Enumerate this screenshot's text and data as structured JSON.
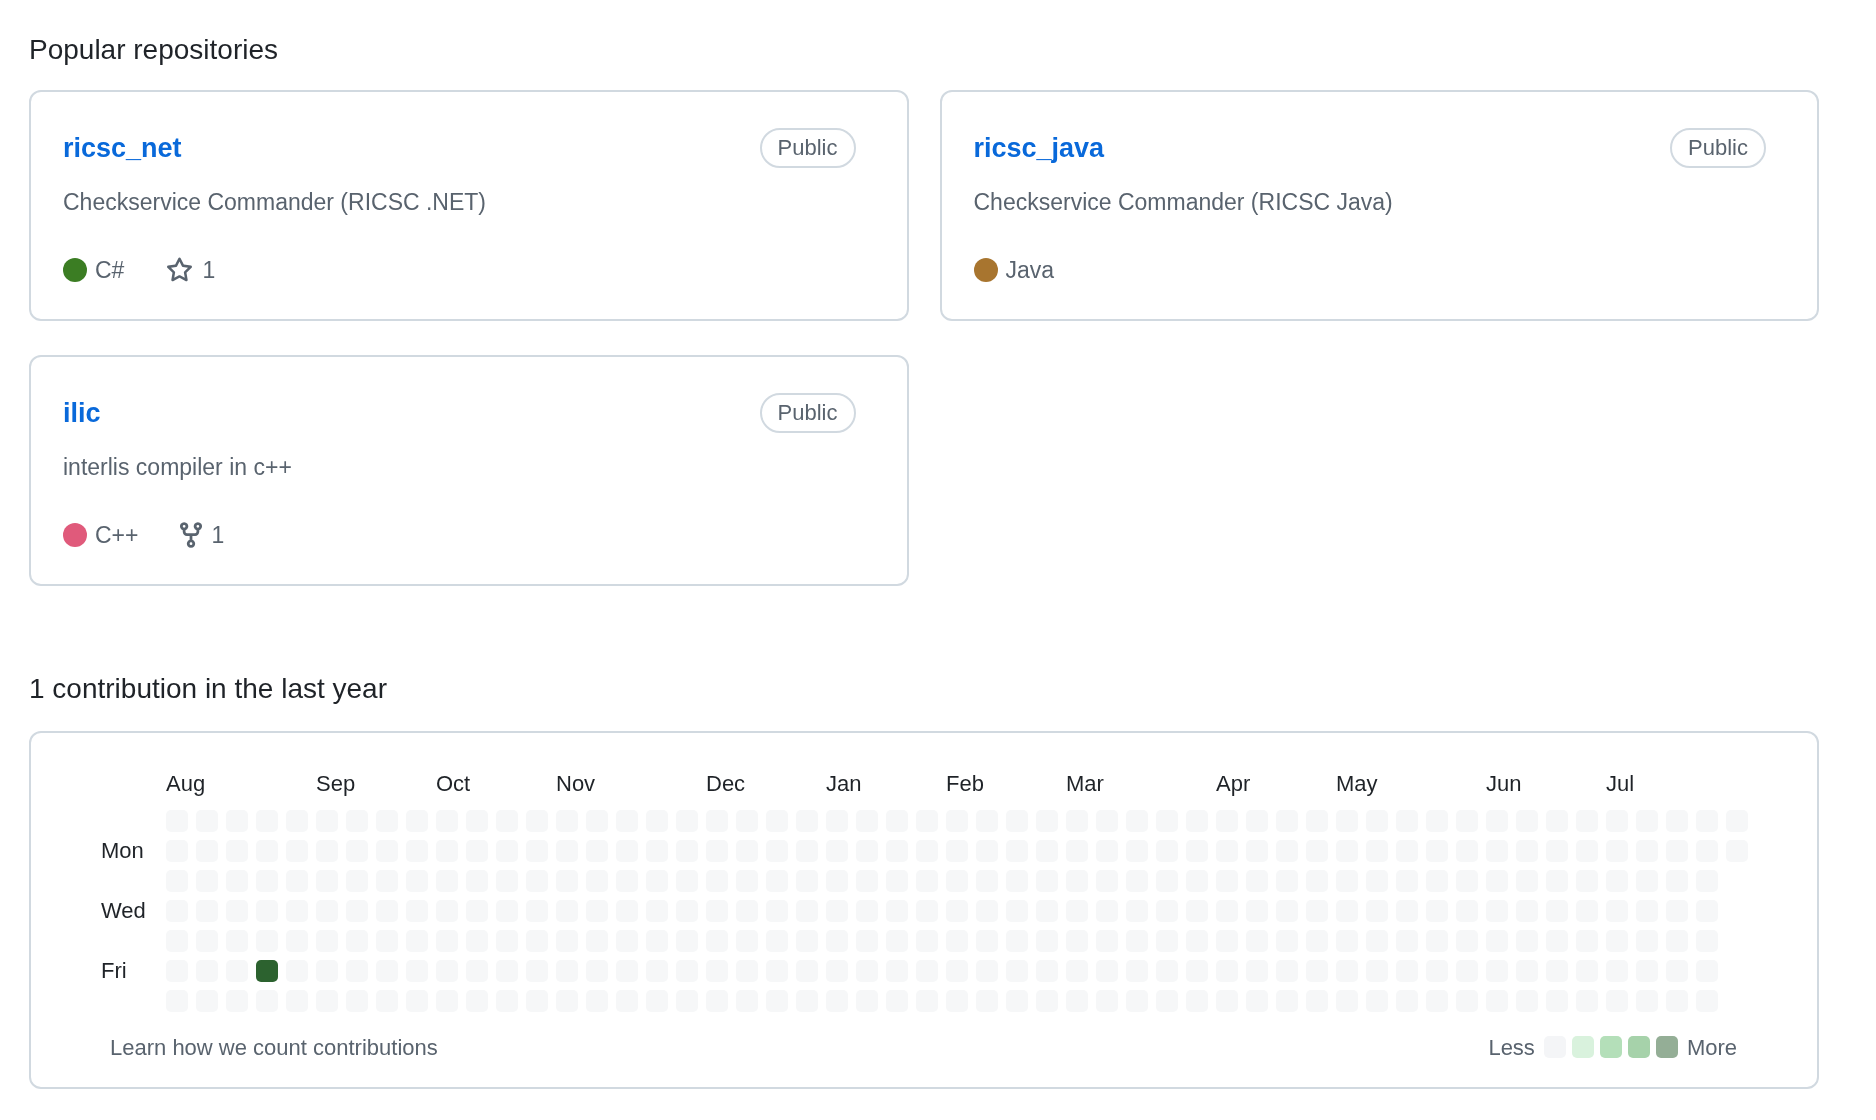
{
  "popular_repositories": {
    "title": "Popular repositories",
    "repos": [
      {
        "name": "ricsc_net",
        "visibility": "Public",
        "description": "Checkservice Commander (RICSC .NET)",
        "language": {
          "name": "C#",
          "color": "#3b7d23"
        },
        "stats": [
          {
            "kind": "stars",
            "count": "1"
          }
        ]
      },
      {
        "name": "ricsc_java",
        "visibility": "Public",
        "description": "Checkservice Commander (RICSC Java)",
        "language": {
          "name": "Java",
          "color": "#a8752f"
        }
      },
      {
        "name": "ilic",
        "visibility": "Public",
        "description": "interlis compiler in c++",
        "language": {
          "name": "C++",
          "color": "#e05a7b"
        },
        "stats": [
          {
            "kind": "forks",
            "count": "1"
          }
        ]
      }
    ]
  },
  "contributions": {
    "title": "1 contribution in the last year",
    "day_labels": [
      "Mon",
      "Wed",
      "Fri"
    ],
    "weeks": [
      {
        "month": "Aug",
        "days": [
          {
            "color": "#f6f7f8"
          },
          {
            "color": "#f6f7f8"
          },
          {
            "color": "#f6f7f8"
          },
          {
            "color": "#f6f7f8"
          },
          {
            "color": "#f6f7f8"
          },
          {
            "color": "#f6f7f8"
          },
          {
            "color": "#f6f7f8"
          }
        ]
      },
      {
        "days": [
          {
            "color": "#f6f7f8"
          },
          {
            "color": "#f6f7f8"
          },
          {
            "color": "#f6f7f8"
          },
          {
            "color": "#f6f7f8"
          },
          {
            "color": "#f6f7f8"
          },
          {
            "color": "#f6f7f8"
          },
          {
            "color": "#f6f7f8"
          }
        ]
      },
      {
        "days": [
          {
            "color": "#f6f7f8"
          },
          {
            "color": "#f6f7f8"
          },
          {
            "color": "#f6f7f8"
          },
          {
            "color": "#f6f7f8"
          },
          {
            "color": "#f6f7f8"
          },
          {
            "color": "#f6f7f8"
          },
          {
            "color": "#f6f7f8"
          }
        ]
      },
      {
        "days": [
          {
            "color": "#f6f7f8"
          },
          {
            "color": "#f6f7f8"
          },
          {
            "color": "#f6f7f8"
          },
          {
            "color": "#f6f7f8"
          },
          {
            "color": "#f6f7f8"
          },
          {
            "color": "#2c622f"
          },
          {
            "color": "#f6f7f8"
          }
        ]
      },
      {
        "days": [
          {
            "color": "#f6f7f8"
          },
          {
            "color": "#f6f7f8"
          },
          {
            "color": "#f6f7f8"
          },
          {
            "color": "#f6f7f8"
          },
          {
            "color": "#f6f7f8"
          },
          {
            "color": "#f6f7f8"
          },
          {
            "color": "#f6f7f8"
          }
        ]
      },
      {
        "month": "Sep",
        "days": [
          {
            "color": "#f6f7f8"
          },
          {
            "color": "#f6f7f8"
          },
          {
            "color": "#f6f7f8"
          },
          {
            "color": "#f6f7f8"
          },
          {
            "color": "#f6f7f8"
          },
          {
            "color": "#f6f7f8"
          },
          {
            "color": "#f6f7f8"
          }
        ]
      },
      {
        "days": [
          {
            "color": "#f6f7f8"
          },
          {
            "color": "#f6f7f8"
          },
          {
            "color": "#f6f7f8"
          },
          {
            "color": "#f6f7f8"
          },
          {
            "color": "#f6f7f8"
          },
          {
            "color": "#f6f7f8"
          },
          {
            "color": "#f6f7f8"
          }
        ]
      },
      {
        "days": [
          {
            "color": "#f6f7f8"
          },
          {
            "color": "#f6f7f8"
          },
          {
            "color": "#f6f7f8"
          },
          {
            "color": "#f6f7f8"
          },
          {
            "color": "#f6f7f8"
          },
          {
            "color": "#f6f7f8"
          },
          {
            "color": "#f6f7f8"
          }
        ]
      },
      {
        "days": [
          {
            "color": "#f6f7f8"
          },
          {
            "color": "#f6f7f8"
          },
          {
            "color": "#f6f7f8"
          },
          {
            "color": "#f6f7f8"
          },
          {
            "color": "#f6f7f8"
          },
          {
            "color": "#f6f7f8"
          },
          {
            "color": "#f6f7f8"
          }
        ]
      },
      {
        "month": "Oct",
        "days": [
          {
            "color": "#f6f7f8"
          },
          {
            "color": "#f6f7f8"
          },
          {
            "color": "#f6f7f8"
          },
          {
            "color": "#f6f7f8"
          },
          {
            "color": "#f6f7f8"
          },
          {
            "color": "#f6f7f8"
          },
          {
            "color": "#f6f7f8"
          }
        ]
      },
      {
        "days": [
          {
            "color": "#f6f7f8"
          },
          {
            "color": "#f6f7f8"
          },
          {
            "color": "#f6f7f8"
          },
          {
            "color": "#f6f7f8"
          },
          {
            "color": "#f6f7f8"
          },
          {
            "color": "#f6f7f8"
          },
          {
            "color": "#f6f7f8"
          }
        ]
      },
      {
        "days": [
          {
            "color": "#f6f7f8"
          },
          {
            "color": "#f6f7f8"
          },
          {
            "color": "#f6f7f8"
          },
          {
            "color": "#f6f7f8"
          },
          {
            "color": "#f6f7f8"
          },
          {
            "color": "#f6f7f8"
          },
          {
            "color": "#f6f7f8"
          }
        ]
      },
      {
        "days": [
          {
            "color": "#f6f7f8"
          },
          {
            "color": "#f6f7f8"
          },
          {
            "color": "#f6f7f8"
          },
          {
            "color": "#f6f7f8"
          },
          {
            "color": "#f6f7f8"
          },
          {
            "color": "#f6f7f8"
          },
          {
            "color": "#f6f7f8"
          }
        ]
      },
      {
        "month": "Nov",
        "days": [
          {
            "color": "#f6f7f8"
          },
          {
            "color": "#f6f7f8"
          },
          {
            "color": "#f6f7f8"
          },
          {
            "color": "#f6f7f8"
          },
          {
            "color": "#f6f7f8"
          },
          {
            "color": "#f6f7f8"
          },
          {
            "color": "#f6f7f8"
          }
        ]
      },
      {
        "days": [
          {
            "color": "#f6f7f8"
          },
          {
            "color": "#f6f7f8"
          },
          {
            "color": "#f6f7f8"
          },
          {
            "color": "#f6f7f8"
          },
          {
            "color": "#f6f7f8"
          },
          {
            "color": "#f6f7f8"
          },
          {
            "color": "#f6f7f8"
          }
        ]
      },
      {
        "days": [
          {
            "color": "#f6f7f8"
          },
          {
            "color": "#f6f7f8"
          },
          {
            "color": "#f6f7f8"
          },
          {
            "color": "#f6f7f8"
          },
          {
            "color": "#f6f7f8"
          },
          {
            "color": "#f6f7f8"
          },
          {
            "color": "#f6f7f8"
          }
        ]
      },
      {
        "days": [
          {
            "color": "#f6f7f8"
          },
          {
            "color": "#f6f7f8"
          },
          {
            "color": "#f6f7f8"
          },
          {
            "color": "#f6f7f8"
          },
          {
            "color": "#f6f7f8"
          },
          {
            "color": "#f6f7f8"
          },
          {
            "color": "#f6f7f8"
          }
        ]
      },
      {
        "days": [
          {
            "color": "#f6f7f8"
          },
          {
            "color": "#f6f7f8"
          },
          {
            "color": "#f6f7f8"
          },
          {
            "color": "#f6f7f8"
          },
          {
            "color": "#f6f7f8"
          },
          {
            "color": "#f6f7f8"
          },
          {
            "color": "#f6f7f8"
          }
        ]
      },
      {
        "month": "Dec",
        "days": [
          {
            "color": "#f6f7f8"
          },
          {
            "color": "#f6f7f8"
          },
          {
            "color": "#f6f7f8"
          },
          {
            "color": "#f6f7f8"
          },
          {
            "color": "#f6f7f8"
          },
          {
            "color": "#f6f7f8"
          },
          {
            "color": "#f6f7f8"
          }
        ]
      },
      {
        "days": [
          {
            "color": "#f6f7f8"
          },
          {
            "color": "#f6f7f8"
          },
          {
            "color": "#f6f7f8"
          },
          {
            "color": "#f6f7f8"
          },
          {
            "color": "#f6f7f8"
          },
          {
            "color": "#f6f7f8"
          },
          {
            "color": "#f6f7f8"
          }
        ]
      },
      {
        "days": [
          {
            "color": "#f6f7f8"
          },
          {
            "color": "#f6f7f8"
          },
          {
            "color": "#f6f7f8"
          },
          {
            "color": "#f6f7f8"
          },
          {
            "color": "#f6f7f8"
          },
          {
            "color": "#f6f7f8"
          },
          {
            "color": "#f6f7f8"
          }
        ]
      },
      {
        "days": [
          {
            "color": "#f6f7f8"
          },
          {
            "color": "#f6f7f8"
          },
          {
            "color": "#f6f7f8"
          },
          {
            "color": "#f6f7f8"
          },
          {
            "color": "#f6f7f8"
          },
          {
            "color": "#f6f7f8"
          },
          {
            "color": "#f6f7f8"
          }
        ]
      },
      {
        "month": "Jan",
        "days": [
          {
            "color": "#f6f7f8"
          },
          {
            "color": "#f6f7f8"
          },
          {
            "color": "#f6f7f8"
          },
          {
            "color": "#f6f7f8"
          },
          {
            "color": "#f6f7f8"
          },
          {
            "color": "#f6f7f8"
          },
          {
            "color": "#f6f7f8"
          }
        ]
      },
      {
        "days": [
          {
            "color": "#f6f7f8"
          },
          {
            "color": "#f6f7f8"
          },
          {
            "color": "#f6f7f8"
          },
          {
            "color": "#f6f7f8"
          },
          {
            "color": "#f6f7f8"
          },
          {
            "color": "#f6f7f8"
          },
          {
            "color": "#f6f7f8"
          }
        ]
      },
      {
        "days": [
          {
            "color": "#f6f7f8"
          },
          {
            "color": "#f6f7f8"
          },
          {
            "color": "#f6f7f8"
          },
          {
            "color": "#f6f7f8"
          },
          {
            "color": "#f6f7f8"
          },
          {
            "color": "#f6f7f8"
          },
          {
            "color": "#f6f7f8"
          }
        ]
      },
      {
        "days": [
          {
            "color": "#f6f7f8"
          },
          {
            "color": "#f6f7f8"
          },
          {
            "color": "#f6f7f8"
          },
          {
            "color": "#f6f7f8"
          },
          {
            "color": "#f6f7f8"
          },
          {
            "color": "#f6f7f8"
          },
          {
            "color": "#f6f7f8"
          }
        ]
      },
      {
        "month": "Feb",
        "days": [
          {
            "color": "#f6f7f8"
          },
          {
            "color": "#f6f7f8"
          },
          {
            "color": "#f6f7f8"
          },
          {
            "color": "#f6f7f8"
          },
          {
            "color": "#f6f7f8"
          },
          {
            "color": "#f6f7f8"
          },
          {
            "color": "#f6f7f8"
          }
        ]
      },
      {
        "days": [
          {
            "color": "#f6f7f8"
          },
          {
            "color": "#f6f7f8"
          },
          {
            "color": "#f6f7f8"
          },
          {
            "color": "#f6f7f8"
          },
          {
            "color": "#f6f7f8"
          },
          {
            "color": "#f6f7f8"
          },
          {
            "color": "#f6f7f8"
          }
        ]
      },
      {
        "days": [
          {
            "color": "#f6f7f8"
          },
          {
            "color": "#f6f7f8"
          },
          {
            "color": "#f6f7f8"
          },
          {
            "color": "#f6f7f8"
          },
          {
            "color": "#f6f7f8"
          },
          {
            "color": "#f6f7f8"
          },
          {
            "color": "#f6f7f8"
          }
        ]
      },
      {
        "days": [
          {
            "color": "#f6f7f8"
          },
          {
            "color": "#f6f7f8"
          },
          {
            "color": "#f6f7f8"
          },
          {
            "color": "#f6f7f8"
          },
          {
            "color": "#f6f7f8"
          },
          {
            "color": "#f6f7f8"
          },
          {
            "color": "#f6f7f8"
          }
        ]
      },
      {
        "month": "Mar",
        "days": [
          {
            "color": "#f6f7f8"
          },
          {
            "color": "#f6f7f8"
          },
          {
            "color": "#f6f7f8"
          },
          {
            "color": "#f6f7f8"
          },
          {
            "color": "#f6f7f8"
          },
          {
            "color": "#f6f7f8"
          },
          {
            "color": "#f6f7f8"
          }
        ]
      },
      {
        "days": [
          {
            "color": "#f6f7f8"
          },
          {
            "color": "#f6f7f8"
          },
          {
            "color": "#f6f7f8"
          },
          {
            "color": "#f6f7f8"
          },
          {
            "color": "#f6f7f8"
          },
          {
            "color": "#f6f7f8"
          },
          {
            "color": "#f6f7f8"
          }
        ]
      },
      {
        "days": [
          {
            "color": "#f6f7f8"
          },
          {
            "color": "#f6f7f8"
          },
          {
            "color": "#f6f7f8"
          },
          {
            "color": "#f6f7f8"
          },
          {
            "color": "#f6f7f8"
          },
          {
            "color": "#f6f7f8"
          },
          {
            "color": "#f6f7f8"
          }
        ]
      },
      {
        "days": [
          {
            "color": "#f6f7f8"
          },
          {
            "color": "#f6f7f8"
          },
          {
            "color": "#f6f7f8"
          },
          {
            "color": "#f6f7f8"
          },
          {
            "color": "#f6f7f8"
          },
          {
            "color": "#f6f7f8"
          },
          {
            "color": "#f6f7f8"
          }
        ]
      },
      {
        "days": [
          {
            "color": "#f6f7f8"
          },
          {
            "color": "#f6f7f8"
          },
          {
            "color": "#f6f7f8"
          },
          {
            "color": "#f6f7f8"
          },
          {
            "color": "#f6f7f8"
          },
          {
            "color": "#f6f7f8"
          },
          {
            "color": "#f6f7f8"
          }
        ]
      },
      {
        "month": "Apr",
        "days": [
          {
            "color": "#f6f7f8"
          },
          {
            "color": "#f6f7f8"
          },
          {
            "color": "#f6f7f8"
          },
          {
            "color": "#f6f7f8"
          },
          {
            "color": "#f6f7f8"
          },
          {
            "color": "#f6f7f8"
          },
          {
            "color": "#f6f7f8"
          }
        ]
      },
      {
        "days": [
          {
            "color": "#f6f7f8"
          },
          {
            "color": "#f6f7f8"
          },
          {
            "color": "#f6f7f8"
          },
          {
            "color": "#f6f7f8"
          },
          {
            "color": "#f6f7f8"
          },
          {
            "color": "#f6f7f8"
          },
          {
            "color": "#f6f7f8"
          }
        ]
      },
      {
        "days": [
          {
            "color": "#f6f7f8"
          },
          {
            "color": "#f6f7f8"
          },
          {
            "color": "#f6f7f8"
          },
          {
            "color": "#f6f7f8"
          },
          {
            "color": "#f6f7f8"
          },
          {
            "color": "#f6f7f8"
          },
          {
            "color": "#f6f7f8"
          }
        ]
      },
      {
        "days": [
          {
            "color": "#f6f7f8"
          },
          {
            "color": "#f6f7f8"
          },
          {
            "color": "#f6f7f8"
          },
          {
            "color": "#f6f7f8"
          },
          {
            "color": "#f6f7f8"
          },
          {
            "color": "#f6f7f8"
          },
          {
            "color": "#f6f7f8"
          }
        ]
      },
      {
        "month": "May",
        "days": [
          {
            "color": "#f6f7f8"
          },
          {
            "color": "#f6f7f8"
          },
          {
            "color": "#f6f7f8"
          },
          {
            "color": "#f6f7f8"
          },
          {
            "color": "#f6f7f8"
          },
          {
            "color": "#f6f7f8"
          },
          {
            "color": "#f6f7f8"
          }
        ]
      },
      {
        "days": [
          {
            "color": "#f6f7f8"
          },
          {
            "color": "#f6f7f8"
          },
          {
            "color": "#f6f7f8"
          },
          {
            "color": "#f6f7f8"
          },
          {
            "color": "#f6f7f8"
          },
          {
            "color": "#f6f7f8"
          },
          {
            "color": "#f6f7f8"
          }
        ]
      },
      {
        "days": [
          {
            "color": "#f6f7f8"
          },
          {
            "color": "#f6f7f8"
          },
          {
            "color": "#f6f7f8"
          },
          {
            "color": "#f6f7f8"
          },
          {
            "color": "#f6f7f8"
          },
          {
            "color": "#f6f7f8"
          },
          {
            "color": "#f6f7f8"
          }
        ]
      },
      {
        "days": [
          {
            "color": "#f6f7f8"
          },
          {
            "color": "#f6f7f8"
          },
          {
            "color": "#f6f7f8"
          },
          {
            "color": "#f6f7f8"
          },
          {
            "color": "#f6f7f8"
          },
          {
            "color": "#f6f7f8"
          },
          {
            "color": "#f6f7f8"
          }
        ]
      },
      {
        "days": [
          {
            "color": "#f6f7f8"
          },
          {
            "color": "#f6f7f8"
          },
          {
            "color": "#f6f7f8"
          },
          {
            "color": "#f6f7f8"
          },
          {
            "color": "#f6f7f8"
          },
          {
            "color": "#f6f7f8"
          },
          {
            "color": "#f6f7f8"
          }
        ]
      },
      {
        "month": "Jun",
        "days": [
          {
            "color": "#f6f7f8"
          },
          {
            "color": "#f6f7f8"
          },
          {
            "color": "#f6f7f8"
          },
          {
            "color": "#f6f7f8"
          },
          {
            "color": "#f6f7f8"
          },
          {
            "color": "#f6f7f8"
          },
          {
            "color": "#f6f7f8"
          }
        ]
      },
      {
        "days": [
          {
            "color": "#f6f7f8"
          },
          {
            "color": "#f6f7f8"
          },
          {
            "color": "#f6f7f8"
          },
          {
            "color": "#f6f7f8"
          },
          {
            "color": "#f6f7f8"
          },
          {
            "color": "#f6f7f8"
          },
          {
            "color": "#f6f7f8"
          }
        ]
      },
      {
        "days": [
          {
            "color": "#f6f7f8"
          },
          {
            "color": "#f6f7f8"
          },
          {
            "color": "#f6f7f8"
          },
          {
            "color": "#f6f7f8"
          },
          {
            "color": "#f6f7f8"
          },
          {
            "color": "#f6f7f8"
          },
          {
            "color": "#f6f7f8"
          }
        ]
      },
      {
        "days": [
          {
            "color": "#f6f7f8"
          },
          {
            "color": "#f6f7f8"
          },
          {
            "color": "#f6f7f8"
          },
          {
            "color": "#f6f7f8"
          },
          {
            "color": "#f6f7f8"
          },
          {
            "color": "#f6f7f8"
          },
          {
            "color": "#f6f7f8"
          }
        ]
      },
      {
        "month": "Jul",
        "days": [
          {
            "color": "#f6f7f8"
          },
          {
            "color": "#f6f7f8"
          },
          {
            "color": "#f6f7f8"
          },
          {
            "color": "#f6f7f8"
          },
          {
            "color": "#f6f7f8"
          },
          {
            "color": "#f6f7f8"
          },
          {
            "color": "#f6f7f8"
          }
        ]
      },
      {
        "days": [
          {
            "color": "#f6f7f8"
          },
          {
            "color": "#f6f7f8"
          },
          {
            "color": "#f6f7f8"
          },
          {
            "color": "#f6f7f8"
          },
          {
            "color": "#f6f7f8"
          },
          {
            "color": "#f6f7f8"
          },
          {
            "color": "#f6f7f8"
          }
        ]
      },
      {
        "days": [
          {
            "color": "#f6f7f8"
          },
          {
            "color": "#f6f7f8"
          },
          {
            "color": "#f6f7f8"
          },
          {
            "color": "#f6f7f8"
          },
          {
            "color": "#f6f7f8"
          },
          {
            "color": "#f6f7f8"
          },
          {
            "color": "#f6f7f8"
          }
        ]
      },
      {
        "days": [
          {
            "color": "#f6f7f8"
          },
          {
            "color": "#f6f7f8"
          },
          {
            "color": "#f6f7f8"
          },
          {
            "color": "#f6f7f8"
          },
          {
            "color": "#f6f7f8"
          },
          {
            "color": "#f6f7f8"
          },
          {
            "color": "#f6f7f8"
          }
        ]
      },
      {
        "days": [
          {
            "color": "#f6f7f8"
          },
          {
            "color": "#f6f7f8"
          }
        ]
      }
    ],
    "footer_link": "Learn how we count contributions",
    "legend": {
      "less": "Less",
      "more": "More",
      "swatches": [
        {
          "color": "#f4f5f7"
        },
        {
          "color": "#d9f2dd"
        },
        {
          "color": "#b4dfb9"
        },
        {
          "color": "#a6d2aa"
        },
        {
          "color": "#94ae96"
        }
      ]
    }
  }
}
